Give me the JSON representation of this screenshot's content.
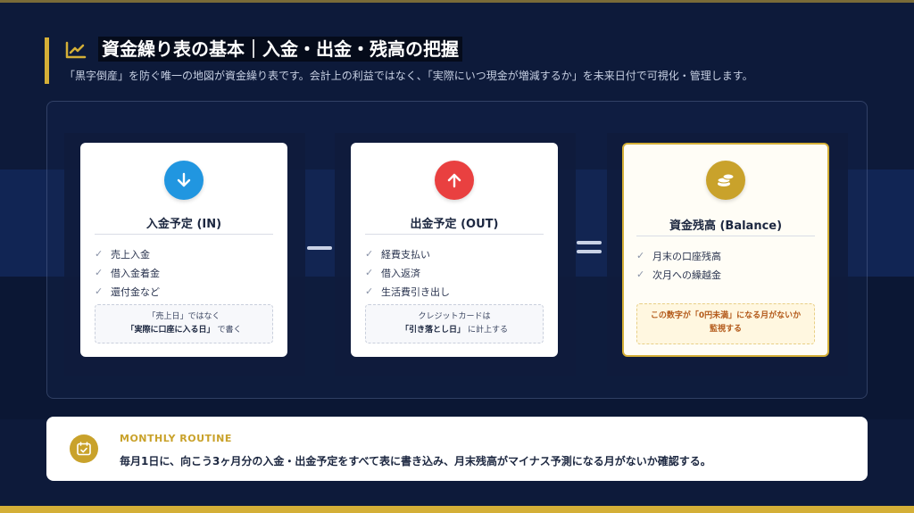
{
  "header": {
    "title": "資金繰り表の基本｜入金・出金・残高の把握",
    "subtitle": "「黒字倒産」を防ぐ唯一の地図が資金繰り表です。会計上の利益ではなく、「実際にいつ現金が増減するか」を未来日付で可視化・管理します。",
    "icon": "trend-chart-icon"
  },
  "cards": [
    {
      "title": "入金予定 (IN)",
      "icon": "arrow-down-icon",
      "color": "#2196e0",
      "items": [
        "売上入金",
        "借入金着金",
        "還付金など"
      ],
      "note_line1": "「売上日」ではなく",
      "note_bold": "「実際に口座に入る日」",
      "note_tail": "で書く"
    },
    {
      "title": "出金予定 (OUT)",
      "icon": "arrow-up-icon",
      "color": "#e94040",
      "items": [
        "経費支払い",
        "借入返済",
        "生活費引き出し"
      ],
      "note_line1": "クレジットカードは",
      "note_bold": "「引き落とし日」",
      "note_tail": "に計上する"
    },
    {
      "title": "資金残高 (Balance)",
      "icon": "coins-icon",
      "color": "#c9a22b",
      "items": [
        "月末の口座残高",
        "次月への繰越金"
      ],
      "note_line1": "この数字が「0円未満」になる月がないか",
      "note_line2": "監視する"
    }
  ],
  "operators": {
    "minus": "minus-operator",
    "equals": "equals-operator"
  },
  "routine": {
    "label": "MONTHLY ROUTINE",
    "text": "毎月1日に、向こう3ヶ月分の入金・出金予定をすべて表に書き込み、月末残高がマイナス予測になる月がないか確認する。",
    "icon": "calendar-check-icon"
  },
  "colors": {
    "accent": "#d4af37",
    "background": "#0d1a3a",
    "in": "#2196e0",
    "out": "#e94040",
    "balance": "#c9a22b"
  }
}
